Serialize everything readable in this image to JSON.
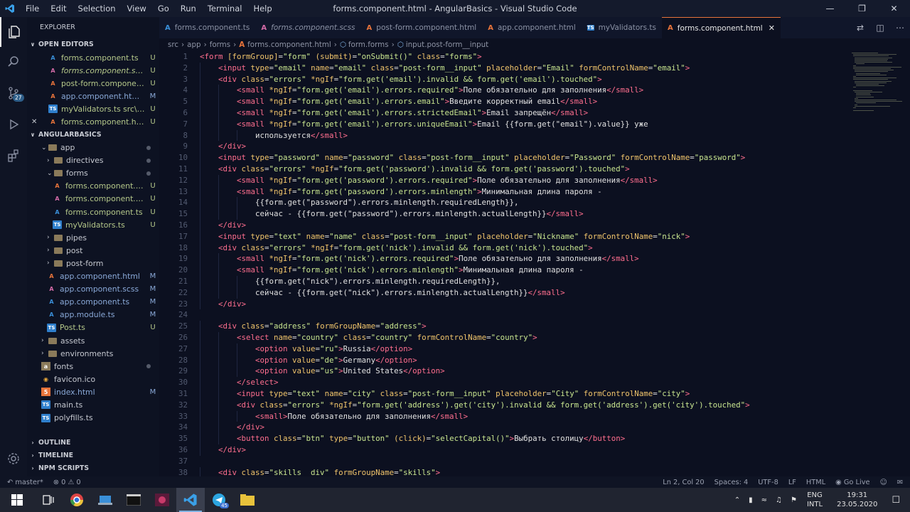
{
  "titlebar": {
    "menu": [
      "File",
      "Edit",
      "Selection",
      "View",
      "Go",
      "Run",
      "Terminal",
      "Help"
    ],
    "title": "forms.component.html - AngularBasics - Visual Studio Code"
  },
  "activity": {
    "items": [
      "files-icon",
      "search-icon",
      "source-control-icon",
      "run-debug-icon",
      "extensions-icon"
    ],
    "scm_badge": "27"
  },
  "sidebar": {
    "title": "EXPLORER",
    "open_editors_label": "OPEN EDITORS",
    "open_editors": [
      {
        "name": "forms.component.ts",
        "type": "ts",
        "status": "U"
      },
      {
        "name": "forms.component.scss ...",
        "type": "scss",
        "status": "U"
      },
      {
        "name": "post-form.componen...",
        "type": "ang",
        "status": "U"
      },
      {
        "name": "app.component.html...",
        "type": "ang",
        "status": "M"
      },
      {
        "name": "myValidators.ts src\\ap...",
        "type": "tsb",
        "status": "U"
      },
      {
        "name": "forms.component.ht...",
        "type": "ang",
        "status": "U",
        "closeable": true
      }
    ],
    "project_label": "ANGULARBASICS",
    "tree": [
      {
        "name": "app",
        "indent": 1,
        "kind": "folder-open",
        "dot": true
      },
      {
        "name": "directives",
        "indent": 2,
        "kind": "folder",
        "dot": true
      },
      {
        "name": "forms",
        "indent": 2,
        "kind": "folder-open",
        "dot": true
      },
      {
        "name": "forms.component.html",
        "indent": 3,
        "kind": "ang",
        "status": "U"
      },
      {
        "name": "forms.component.scss",
        "indent": 3,
        "kind": "scss",
        "status": "U"
      },
      {
        "name": "forms.component.ts",
        "indent": 3,
        "kind": "ts",
        "status": "U"
      },
      {
        "name": "myValidators.ts",
        "indent": 3,
        "kind": "tsb",
        "status": "U"
      },
      {
        "name": "pipes",
        "indent": 2,
        "kind": "folder"
      },
      {
        "name": "post",
        "indent": 2,
        "kind": "folder"
      },
      {
        "name": "post-form",
        "indent": 2,
        "kind": "folder"
      },
      {
        "name": "app.component.html",
        "indent": 2,
        "kind": "ang",
        "status": "M"
      },
      {
        "name": "app.component.scss",
        "indent": 2,
        "kind": "scss",
        "status": "M"
      },
      {
        "name": "app.component.ts",
        "indent": 2,
        "kind": "ts",
        "status": "M"
      },
      {
        "name": "app.module.ts",
        "indent": 2,
        "kind": "ts",
        "status": "M"
      },
      {
        "name": "Post.ts",
        "indent": 2,
        "kind": "tsb",
        "status": "U"
      },
      {
        "name": "assets",
        "indent": 1,
        "kind": "folder"
      },
      {
        "name": "environments",
        "indent": 1,
        "kind": "folder"
      },
      {
        "name": "fonts",
        "indent": 1,
        "kind": "font",
        "dot": true
      },
      {
        "name": "favicon.ico",
        "indent": 1,
        "kind": "fav"
      },
      {
        "name": "index.html",
        "indent": 1,
        "kind": "html5",
        "status": "M"
      },
      {
        "name": "main.ts",
        "indent": 1,
        "kind": "tsb"
      },
      {
        "name": "polyfills.ts",
        "indent": 1,
        "kind": "tsb"
      }
    ],
    "bottom_sections": [
      "OUTLINE",
      "TIMELINE",
      "NPM SCRIPTS"
    ]
  },
  "tabs": [
    {
      "label": "forms.component.ts",
      "type": "ts"
    },
    {
      "label": "forms.component.scss",
      "type": "scss"
    },
    {
      "label": "post-form.component.html",
      "type": "ang"
    },
    {
      "label": "app.component.html",
      "type": "ang"
    },
    {
      "label": "myValidators.ts",
      "type": "tsb"
    },
    {
      "label": "forms.component.html",
      "type": "ang",
      "active": true
    }
  ],
  "breadcrumb": [
    "src",
    "app",
    "forms",
    "forms.component.html",
    "form.forms",
    "input.post-form__input"
  ],
  "code_lines": [
    {
      "n": 1,
      "i": 0,
      "t": "<form [formGroup]=\"form\" (submit)=\"onSubmit()\" class=\"forms\">"
    },
    {
      "n": 2,
      "i": 1,
      "t": "<input type=\"email\" name=\"email\" class=\"post-form__input\" placeholder=\"Email\" formControlName=\"email\">"
    },
    {
      "n": 3,
      "i": 1,
      "t": "<div class=\"errors\" *ngIf=\"form.get('email').invalid && form.get('email').touched\">"
    },
    {
      "n": 4,
      "i": 2,
      "t": "<small *ngIf=\"form.get('email').errors.required\">Поле обязательно для заполнения</small>"
    },
    {
      "n": 5,
      "i": 2,
      "t": "<small *ngIf=\"form.get('email').errors.email\">Введите корректный email</small>"
    },
    {
      "n": 6,
      "i": 2,
      "t": "<small *ngIf=\"form.get('email').errors.strictedEmail\">Email запрещён</small>"
    },
    {
      "n": 7,
      "i": 2,
      "t": "<small *ngIf=\"form.get('email').errors.uniqueEmail\">Email {{form.get(\"email\").value}} уже"
    },
    {
      "n": 8,
      "i": 3,
      "t": "используется</small>"
    },
    {
      "n": 9,
      "i": 1,
      "t": "</div>"
    },
    {
      "n": 10,
      "i": 1,
      "t": "<input type=\"password\" name=\"password\" class=\"post-form__input\" placeholder=\"Password\" formControlName=\"password\">"
    },
    {
      "n": 11,
      "i": 1,
      "t": "<div class=\"errors\" *ngIf=\"form.get('password').invalid && form.get('password').touched\">"
    },
    {
      "n": 12,
      "i": 2,
      "t": "<small *ngIf=\"form.get('password').errors.required\">Поле обязательно для заполнения</small>"
    },
    {
      "n": 13,
      "i": 2,
      "t": "<small *ngIf=\"form.get('password').errors.minlength\">Минимальная длина пароля -"
    },
    {
      "n": 14,
      "i": 3,
      "t": "{{form.get(\"password\").errors.minlength.requiredLength}},"
    },
    {
      "n": 15,
      "i": 3,
      "t": "сейчас - {{form.get(\"password\").errors.minlength.actualLength}}</small>"
    },
    {
      "n": 16,
      "i": 1,
      "t": "</div>"
    },
    {
      "n": 17,
      "i": 1,
      "t": "<input type=\"text\" name=\"name\" class=\"post-form__input\" placeholder=\"Nickname\" formControlName=\"nick\">"
    },
    {
      "n": 18,
      "i": 1,
      "t": "<div class=\"errors\" *ngIf=\"form.get('nick').invalid && form.get('nick').touched\">"
    },
    {
      "n": 19,
      "i": 2,
      "t": "<small *ngIf=\"form.get('nick').errors.required\">Поле обязательно для заполнения</small>"
    },
    {
      "n": 20,
      "i": 2,
      "t": "<small *ngIf=\"form.get('nick').errors.minlength\">Минимальная длина пароля -"
    },
    {
      "n": 21,
      "i": 3,
      "t": "{{form.get(\"nick\").errors.minlength.requiredLength}},"
    },
    {
      "n": 22,
      "i": 3,
      "t": "сейчас - {{form.get(\"nick\").errors.minlength.actualLength}}</small>"
    },
    {
      "n": 23,
      "i": 1,
      "t": "</div>"
    },
    {
      "n": 24,
      "i": 0,
      "t": ""
    },
    {
      "n": 25,
      "i": 1,
      "t": "<div class=\"address\" formGroupName=\"address\">"
    },
    {
      "n": 26,
      "i": 2,
      "t": "<select name=\"country\" class=\"country\" formControlName=\"country\">"
    },
    {
      "n": 27,
      "i": 3,
      "t": "<option value=\"ru\">Russia</option>"
    },
    {
      "n": 28,
      "i": 3,
      "t": "<option value=\"de\">Germany</option>"
    },
    {
      "n": 29,
      "i": 3,
      "t": "<option value=\"us\">United States</option>"
    },
    {
      "n": 30,
      "i": 2,
      "t": "</select>"
    },
    {
      "n": 31,
      "i": 2,
      "t": "<input type=\"text\" name=\"city\" class=\"post-form__input\" placeholder=\"City\" formControlName=\"city\">"
    },
    {
      "n": 32,
      "i": 2,
      "t": "<div class=\"errors\" *ngIf=\"form.get('address').get('city').invalid && form.get('address').get('city').touched\">"
    },
    {
      "n": 33,
      "i": 3,
      "t": "<small>Поле обязательно для заполнения</small>"
    },
    {
      "n": 34,
      "i": 2,
      "t": "</div>"
    },
    {
      "n": 35,
      "i": 2,
      "t": "<button class=\"btn\" type=\"button\" (click)=\"selectCapital()\">Выбрать столицу</button>"
    },
    {
      "n": 36,
      "i": 1,
      "t": "</div>"
    },
    {
      "n": 37,
      "i": 0,
      "t": ""
    },
    {
      "n": 38,
      "i": 1,
      "t": "<div class=\"skills__div\" formGroupName=\"skills\">"
    }
  ],
  "statusbar": {
    "branch": "master*",
    "problems": "⊗ 0 ⚠ 0",
    "position": "Ln 2, Col 20",
    "spaces": "Spaces: 4",
    "encoding": "UTF-8",
    "eol": "LF",
    "language": "HTML",
    "golive": "Go Live"
  },
  "taskbar": {
    "lang_top": "ENG",
    "lang_bottom": "INTL",
    "time": "19:31",
    "date": "23.05.2020",
    "telegram_badge": "45"
  },
  "colors": {
    "background": "#0c1020",
    "tag": "#ff6e8e",
    "attribute": "#f0c46b",
    "value": "#c8e58f",
    "angular": "#e8743b"
  }
}
